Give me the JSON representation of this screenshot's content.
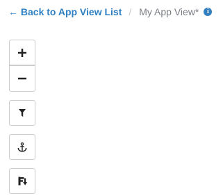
{
  "breadcrumb": {
    "back_label": "← Back to App View List",
    "separator": "/",
    "current_label": "My App View*",
    "info_glyph": "i"
  },
  "toolbar": {
    "zoom_in": {
      "icon": "plus-icon",
      "glyph": "+"
    },
    "zoom_out": {
      "icon": "minus-icon",
      "glyph": "−"
    },
    "filter": {
      "icon": "filter-icon"
    },
    "anchor": {
      "icon": "anchor-icon"
    },
    "layout": {
      "icon": "flow-layout-icon"
    }
  },
  "colors": {
    "link": "#2f7fc1",
    "muted": "#7b8086",
    "separator": "#c8c8c8",
    "border": "#cccccc",
    "icon": "#222222"
  }
}
